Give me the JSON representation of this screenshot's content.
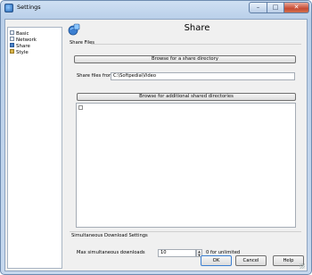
{
  "window": {
    "title": "Settings",
    "controls": {
      "minimize": "–",
      "maximize": "□",
      "close": "✕"
    }
  },
  "nav": {
    "items": [
      {
        "label": "Basic",
        "icon": "settings-page-icon"
      },
      {
        "label": "Network",
        "icon": "network-icon"
      },
      {
        "label": "Share",
        "icon": "share-icon"
      },
      {
        "label": "Style",
        "icon": "style-icon"
      }
    ]
  },
  "page": {
    "title": "Share",
    "share_files_section": "Share Files",
    "browse_share_button": "Browse for a share directory",
    "share_from_label": "Share files from",
    "share_from_value": "C:\\Softpedia\\Video",
    "browse_additional_button": "Browse for additional shared directories",
    "download_section": "Simultaneous Download Settings",
    "max_downloads_label": "Max simultaneous downloads",
    "max_downloads_value": "10",
    "unlimited_hint": "0 for unlimited"
  },
  "footer": {
    "ok_label": "OK",
    "cancel_label": "Cancel",
    "help_label": "Help"
  },
  "colors": {
    "frame": "#b9cfe9",
    "close_button": "#c64a32",
    "accent": "#3c7fd1"
  }
}
